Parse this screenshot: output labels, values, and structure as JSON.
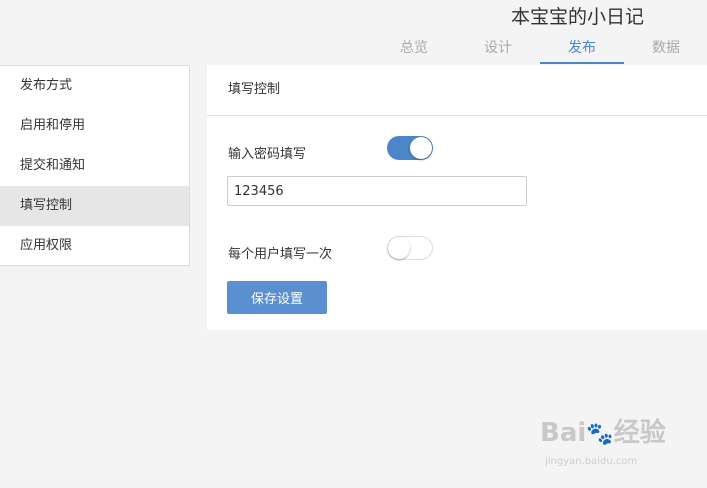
{
  "app": {
    "title": "本宝宝的小日记"
  },
  "tabs": [
    {
      "label": "总览",
      "active": false
    },
    {
      "label": "设计",
      "active": false
    },
    {
      "label": "发布",
      "active": true
    },
    {
      "label": "数据",
      "active": false
    }
  ],
  "sidebar": {
    "items": [
      {
        "label": "发布方式"
      },
      {
        "label": "启用和停用"
      },
      {
        "label": "提交和通知"
      },
      {
        "label": "填写控制",
        "active": true
      },
      {
        "label": "应用权限"
      }
    ]
  },
  "panel": {
    "title": "填写控制",
    "password_fill": {
      "label": "输入密码填写",
      "enabled": true,
      "value": "123456"
    },
    "once_per_user": {
      "label": "每个用户填写一次",
      "enabled": false
    },
    "save_label": "保存设置"
  },
  "watermark": {
    "logo_text": "Bai",
    "logo_text_2": "经验",
    "sub": "jingyan.baidu.com"
  },
  "colors": {
    "accent": "#4a86c8",
    "button": "#5a8fd0",
    "sidebar_active": "#e6e6e6"
  }
}
